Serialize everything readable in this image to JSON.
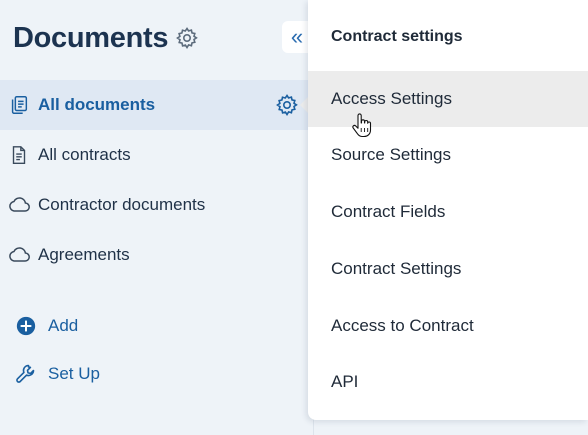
{
  "sidebar": {
    "title": "Documents",
    "collapse_glyph": "«",
    "items": [
      {
        "label": "All documents",
        "icon": "documents-icon",
        "active": true
      },
      {
        "label": "All contracts",
        "icon": "document-icon",
        "active": false
      },
      {
        "label": "Contractor documents",
        "icon": "cloud-icon",
        "active": false
      },
      {
        "label": "Agreements",
        "icon": "cloud-icon",
        "active": false
      }
    ],
    "actions": [
      {
        "label": "Add",
        "icon": "plus-circle-icon"
      },
      {
        "label": "Set Up",
        "icon": "wrench-icon"
      }
    ]
  },
  "menu": {
    "header": "Contract settings",
    "items": [
      {
        "label": "Access Settings",
        "hovered": true
      },
      {
        "label": "Source Settings"
      },
      {
        "label": "Contract Fields"
      },
      {
        "label": "Contract Settings"
      },
      {
        "label": "Access to Contract"
      },
      {
        "label": "API"
      }
    ]
  },
  "colors": {
    "accent": "#1a5fa0",
    "sidebar_bg": "#eef3f8",
    "active_bg": "#dfe8f3",
    "hover_bg": "#ececec"
  }
}
